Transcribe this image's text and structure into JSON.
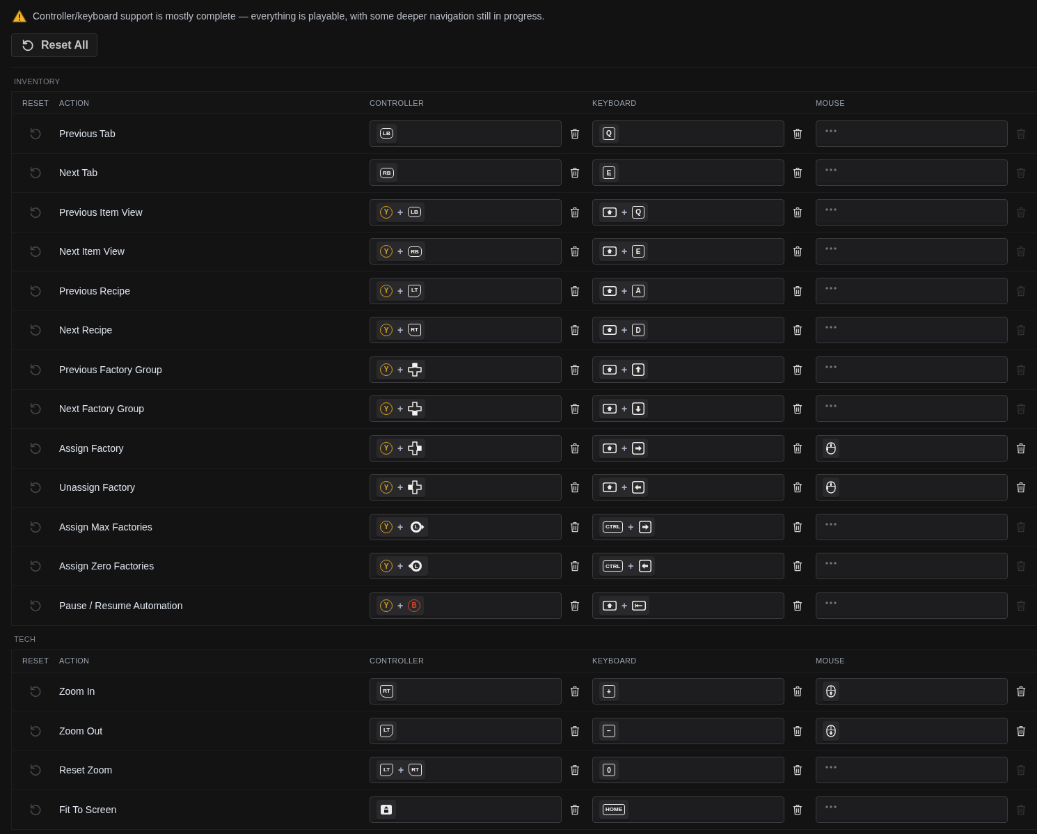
{
  "notice": {
    "text": "Controller/keyboard support is mostly complete — everything is playable, with some deeper navigation still in progress."
  },
  "reset_all": {
    "label": "Reset All"
  },
  "sections": [
    {
      "title": "INVENTORY",
      "columns": [
        "RESET",
        "ACTION",
        "CONTROLLER",
        "KEYBOARD",
        "MOUSE"
      ],
      "rows": [
        {
          "action": "Previous Tab",
          "modified": false,
          "controller": [
            {
              "kind": "bumper",
              "label": "LB"
            }
          ],
          "keyboard": [
            {
              "kind": "key",
              "label": "Q"
            }
          ]
        },
        {
          "action": "Next Tab",
          "modified": false,
          "controller": [
            {
              "kind": "bumper",
              "label": "RB"
            }
          ],
          "keyboard": [
            {
              "kind": "key",
              "label": "E"
            }
          ]
        },
        {
          "action": "Previous Item View",
          "modified": false,
          "controller": [
            {
              "kind": "face",
              "label": "Y",
              "color": "#dba321"
            },
            {
              "kind": "separator",
              "label": "+"
            },
            {
              "kind": "bumper",
              "label": "LB"
            }
          ],
          "keyboard": [
            {
              "kind": "shift"
            },
            {
              "kind": "separator",
              "label": "+"
            },
            {
              "kind": "key",
              "label": "Q"
            }
          ]
        },
        {
          "action": "Next Item View",
          "modified": false,
          "controller": [
            {
              "kind": "face",
              "label": "Y",
              "color": "#dba321"
            },
            {
              "kind": "separator",
              "label": "+"
            },
            {
              "kind": "bumper",
              "label": "RB"
            }
          ],
          "keyboard": [
            {
              "kind": "shift"
            },
            {
              "kind": "separator",
              "label": "+"
            },
            {
              "kind": "key",
              "label": "E"
            }
          ]
        },
        {
          "action": "Previous Recipe",
          "modified": false,
          "controller": [
            {
              "kind": "face",
              "label": "Y",
              "color": "#dba321"
            },
            {
              "kind": "separator",
              "label": "+"
            },
            {
              "kind": "left-trigger",
              "label": "LT"
            }
          ],
          "keyboard": [
            {
              "kind": "shift"
            },
            {
              "kind": "separator",
              "label": "+"
            },
            {
              "kind": "key",
              "label": "A"
            }
          ]
        },
        {
          "action": "Next Recipe",
          "modified": false,
          "controller": [
            {
              "kind": "face",
              "label": "Y",
              "color": "#dba321"
            },
            {
              "kind": "separator",
              "label": "+"
            },
            {
              "kind": "right-trigger",
              "label": "RT"
            }
          ],
          "keyboard": [
            {
              "kind": "shift"
            },
            {
              "kind": "separator",
              "label": "+"
            },
            {
              "kind": "key",
              "label": "D"
            }
          ]
        },
        {
          "action": "Previous Factory Group",
          "modified": false,
          "controller": [
            {
              "kind": "face",
              "label": "Y",
              "color": "#dba321"
            },
            {
              "kind": "separator",
              "label": "+"
            },
            {
              "kind": "dpad-up"
            }
          ],
          "keyboard": [
            {
              "kind": "shift"
            },
            {
              "kind": "separator",
              "label": "+"
            },
            {
              "kind": "up-arrow-key"
            }
          ]
        },
        {
          "action": "Next Factory Group",
          "modified": false,
          "controller": [
            {
              "kind": "face",
              "label": "Y",
              "color": "#dba321"
            },
            {
              "kind": "separator",
              "label": "+"
            },
            {
              "kind": "dpad-down"
            }
          ],
          "keyboard": [
            {
              "kind": "shift"
            },
            {
              "kind": "separator",
              "label": "+"
            },
            {
              "kind": "down-arrow-key"
            }
          ]
        },
        {
          "action": "Assign Factory",
          "modified": false,
          "controller": [
            {
              "kind": "face",
              "label": "Y",
              "color": "#dba321"
            },
            {
              "kind": "separator",
              "label": "+"
            },
            {
              "kind": "dpad-right"
            }
          ],
          "keyboard": [
            {
              "kind": "shift"
            },
            {
              "kind": "separator",
              "label": "+"
            },
            {
              "kind": "right-arrow-key"
            }
          ],
          "mouse": [
            {
              "kind": "mouse-side"
            }
          ]
        },
        {
          "action": "Unassign Factory",
          "modified": false,
          "controller": [
            {
              "kind": "face",
              "label": "Y",
              "color": "#dba321"
            },
            {
              "kind": "separator",
              "label": "+"
            },
            {
              "kind": "dpad-left"
            }
          ],
          "keyboard": [
            {
              "kind": "shift"
            },
            {
              "kind": "separator",
              "label": "+"
            },
            {
              "kind": "left-arrow-key"
            }
          ],
          "mouse": [
            {
              "kind": "mouse-side"
            }
          ]
        },
        {
          "action": "Assign Max Factories",
          "modified": false,
          "controller": [
            {
              "kind": "face",
              "label": "Y",
              "color": "#dba321"
            },
            {
              "kind": "separator",
              "label": "+"
            },
            {
              "kind": "stick-right",
              "label": "L"
            }
          ],
          "keyboard": [
            {
              "kind": "key",
              "label": "CTRL"
            },
            {
              "kind": "separator",
              "label": "+"
            },
            {
              "kind": "right-arrow-key"
            }
          ]
        },
        {
          "action": "Assign Zero Factories",
          "modified": false,
          "controller": [
            {
              "kind": "face",
              "label": "Y",
              "color": "#dba321"
            },
            {
              "kind": "separator",
              "label": "+"
            },
            {
              "kind": "stick-left",
              "label": "L"
            }
          ],
          "keyboard": [
            {
              "kind": "key",
              "label": "CTRL"
            },
            {
              "kind": "separator",
              "label": "+"
            },
            {
              "kind": "left-arrow-key"
            }
          ]
        },
        {
          "action": "Pause / Resume Automation",
          "modified": false,
          "controller": [
            {
              "kind": "face",
              "label": "Y",
              "color": "#dba321"
            },
            {
              "kind": "separator",
              "label": "+"
            },
            {
              "kind": "face",
              "label": "B",
              "color": "#d9472f"
            }
          ],
          "keyboard": [
            {
              "kind": "shift"
            },
            {
              "kind": "separator",
              "label": "+"
            },
            {
              "kind": "backspace"
            }
          ]
        }
      ]
    },
    {
      "title": "TECH",
      "columns": [
        "RESET",
        "ACTION",
        "CONTROLLER",
        "KEYBOARD",
        "MOUSE"
      ],
      "rows": [
        {
          "action": "Zoom In",
          "modified": false,
          "controller": [
            {
              "kind": "right-trigger",
              "label": "RT"
            }
          ],
          "keyboard": [
            {
              "kind": "key",
              "label": "+"
            }
          ],
          "mouse": [
            {
              "kind": "mouse-wheel-up"
            }
          ]
        },
        {
          "action": "Zoom Out",
          "modified": false,
          "controller": [
            {
              "kind": "left-trigger",
              "label": "LT"
            }
          ],
          "keyboard": [
            {
              "kind": "key",
              "label": "−"
            }
          ],
          "mouse": [
            {
              "kind": "mouse-wheel-down"
            }
          ]
        },
        {
          "action": "Reset Zoom",
          "modified": false,
          "controller": [
            {
              "kind": "left-trigger",
              "label": "LT"
            },
            {
              "kind": "separator",
              "label": "+"
            },
            {
              "kind": "right-trigger",
              "label": "RT"
            }
          ],
          "keyboard": [
            {
              "kind": "key",
              "label": "0"
            }
          ]
        },
        {
          "action": "Fit To Screen",
          "modified": false,
          "controller": [
            {
              "kind": "view"
            }
          ],
          "keyboard": [
            {
              "kind": "key",
              "label": "HOME"
            }
          ]
        }
      ]
    }
  ]
}
